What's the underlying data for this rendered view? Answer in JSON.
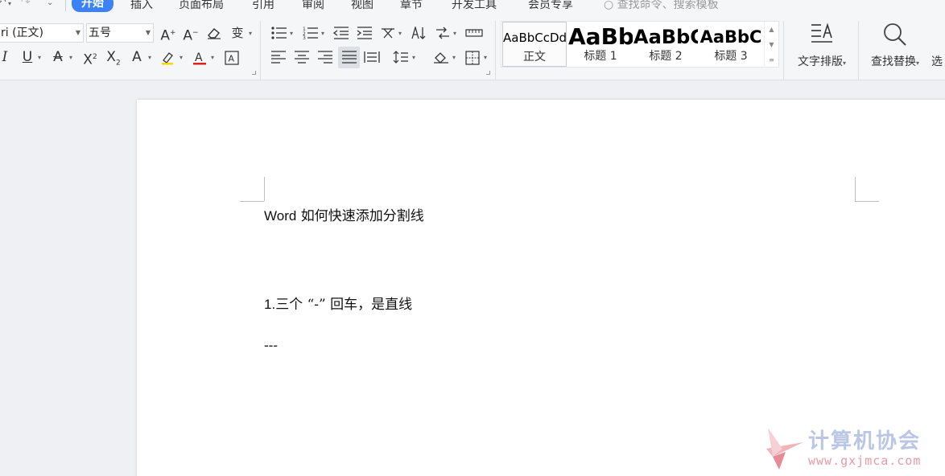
{
  "menubar": {
    "tabs": [
      {
        "label": "开始",
        "active": true
      },
      {
        "label": "插入"
      },
      {
        "label": "页面布局"
      },
      {
        "label": "引用"
      },
      {
        "label": "审阅"
      },
      {
        "label": "视图"
      },
      {
        "label": "章节"
      },
      {
        "label": "开发工具"
      },
      {
        "label": "会员专享"
      }
    ],
    "search_placeholder": "查找命令、搜索模板",
    "accent": "#3b82f6"
  },
  "font": {
    "family": "ri (正文)",
    "size": "五号"
  },
  "styles": {
    "items": [
      {
        "preview": "AaBbCcDd",
        "name": "正文",
        "selected": true
      },
      {
        "preview": "AaBb",
        "name": "标题 1"
      },
      {
        "preview": "AaBbC",
        "name": "标题 2"
      },
      {
        "preview": "AaBbC",
        "name": "标题 3"
      }
    ]
  },
  "buttons": {
    "text_layout": "文字排版",
    "find_replace": "查找替换",
    "select": "选"
  },
  "document": {
    "title_latin": "Word",
    "title_cn": " 如何快速添加分割线",
    "step1_latin": "1.",
    "step1_cn": "三个 “-” 回车，是直线",
    "dashes": "---"
  },
  "watermark": {
    "name": "计算机协会",
    "url": "www.gxjmca.com"
  }
}
